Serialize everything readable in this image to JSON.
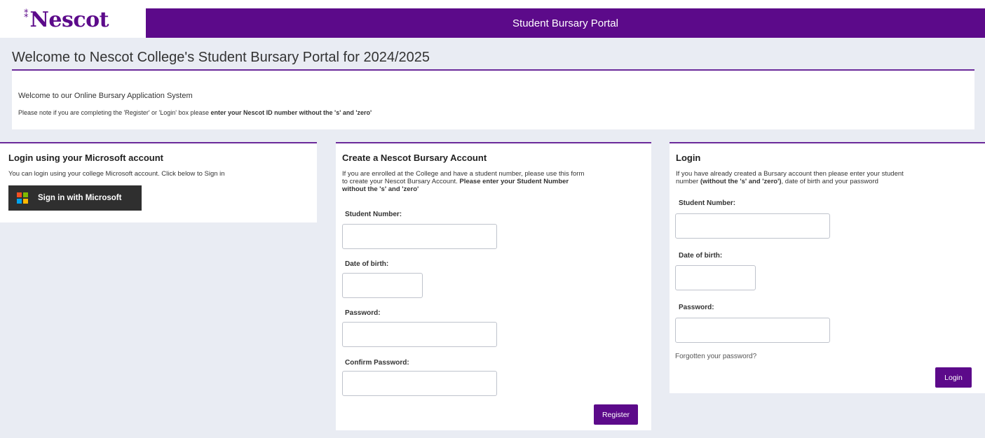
{
  "header": {
    "logo_text": "Nescot",
    "banner_title": "Student Bursary Portal"
  },
  "welcome": {
    "title": "Welcome to Nescot College's Student Bursary Portal for 2024/2025",
    "line1": "Welcome to our Online Bursary Application System",
    "line2_prefix": "Please note if you are completing the 'Register' or 'Login' box please ",
    "line2_bold": "enter your Nescot ID number without the 's' and 'zero'"
  },
  "microsoft_card": {
    "title": "Login using your Microsoft account",
    "description": "You can login using your college Microsoft account. Click below to Sign in",
    "button_label": "Sign in with Microsoft"
  },
  "register_card": {
    "title": "Create a Nescot Bursary Account",
    "description_line1": "If you are enrolled at the College and have a student number, please use this form",
    "description_line2_prefix": "to create your Nescot Bursary Account.  ",
    "description_line2_bold": "Please enter your Student Number",
    "description_line3_bold": "without the 's' and 'zero'",
    "student_number_label": "Student Number:",
    "dob_label": "Date of birth:",
    "password_label": "Password:",
    "confirm_password_label": "Confirm Password:",
    "register_button": "Register"
  },
  "login_card": {
    "title": "Login",
    "description_line1": "If you have already created a Bursary account then please enter your student",
    "description_line2_prefix": "number ",
    "description_line2_bold": "(without the 's' and 'zero')",
    "description_line2_suffix": ", date of birth and your password",
    "student_number_label": "Student Number:",
    "dob_label": "Date of birth:",
    "password_label": "Password:",
    "forgot_link": "Forgotten your password?",
    "login_button": "Login"
  },
  "colors": {
    "brand_purple": "#5c0a8a",
    "page_bg": "#e9ecf3"
  },
  "icons": {
    "microsoft": "microsoft-logo-icon",
    "logo_mark": "nescot-sparkle-icon"
  }
}
